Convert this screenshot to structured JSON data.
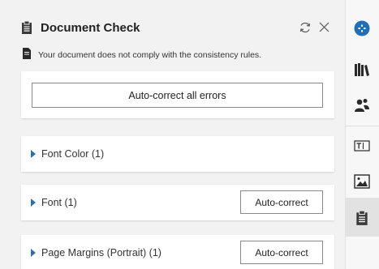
{
  "panel": {
    "title": "Document Check",
    "header_icon": "document-check-icon",
    "warning_icon": "document-icon",
    "warning_text": "Your document does not comply with the consistency rules.",
    "autocorrect_all_label": "Auto-correct all errors",
    "items": [
      {
        "label": "Font Color (1)",
        "has_button": false
      },
      {
        "label": "Font (1)",
        "button_label": "Auto-correct"
      },
      {
        "label": "Page Margins (Portrait) (1)",
        "button_label": "Auto-correct"
      }
    ]
  },
  "rail": {
    "icons": [
      "add-circle-icon",
      "library-icon",
      "people-icon",
      "text-box-icon",
      "image-icon",
      "document-check-icon"
    ],
    "active_index": 5
  },
  "colors": {
    "accent": "#1e6fb8",
    "caret": "#2f6fa7",
    "background": "#f2f2f2"
  }
}
